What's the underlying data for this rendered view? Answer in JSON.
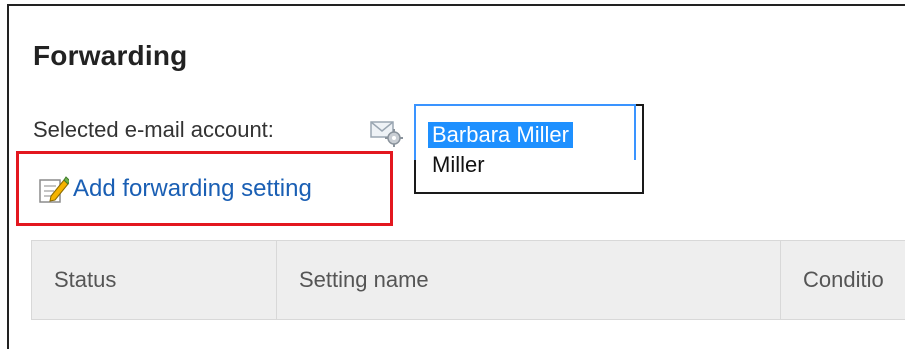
{
  "page": {
    "title": "Forwarding"
  },
  "account": {
    "label": "Selected e-mail account:",
    "icon": "mail-settings-icon",
    "options": [
      "Barbara Miller",
      "Miller"
    ],
    "selected": "Barbara Miller"
  },
  "actions": {
    "add_forwarding": "Add forwarding setting",
    "add_icon": "edit-icon"
  },
  "table": {
    "headers": [
      "Status",
      "Setting name",
      "Conditio"
    ]
  },
  "colors": {
    "highlight": "#e3171f",
    "link": "#1a5fb4",
    "selection": "#1e90ff"
  }
}
